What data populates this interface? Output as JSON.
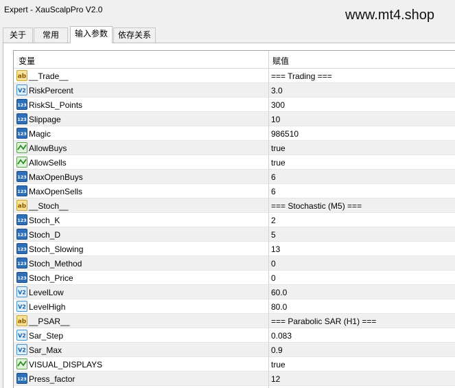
{
  "window": {
    "title": "Expert - XauScalpPro V2.0"
  },
  "watermark": "www.mt4.shop",
  "tabs": [
    {
      "label": "关于",
      "active": false
    },
    {
      "label": "常用",
      "active": false
    },
    {
      "label": "输入参数",
      "active": true
    },
    {
      "label": "依存关系",
      "active": false
    }
  ],
  "columns": {
    "variable": "变量",
    "value": "赋值"
  },
  "params": [
    {
      "icon": "ab-icon",
      "name": "__Trade__",
      "value": "=== Trading ==="
    },
    {
      "icon": "double-icon",
      "name": "RiskPercent",
      "value": "3.0"
    },
    {
      "icon": "integer-icon",
      "name": "RiskSL_Points",
      "value": "300"
    },
    {
      "icon": "integer-icon",
      "name": "Slippage",
      "value": "10"
    },
    {
      "icon": "integer-icon",
      "name": "Magic",
      "value": "986510"
    },
    {
      "icon": "bool-icon",
      "name": "AllowBuys",
      "value": "true"
    },
    {
      "icon": "bool-icon",
      "name": "AllowSells",
      "value": "true"
    },
    {
      "icon": "integer-icon",
      "name": "MaxOpenBuys",
      "value": "6"
    },
    {
      "icon": "integer-icon",
      "name": "MaxOpenSells",
      "value": "6"
    },
    {
      "icon": "ab-icon",
      "name": "__Stoch__",
      "value": "=== Stochastic (M5) ==="
    },
    {
      "icon": "integer-icon",
      "name": "Stoch_K",
      "value": "2"
    },
    {
      "icon": "integer-icon",
      "name": "Stoch_D",
      "value": "5"
    },
    {
      "icon": "integer-icon",
      "name": "Stoch_Slowing",
      "value": "13"
    },
    {
      "icon": "integer-icon",
      "name": "Stoch_Method",
      "value": "0"
    },
    {
      "icon": "integer-icon",
      "name": "Stoch_Price",
      "value": "0"
    },
    {
      "icon": "double-icon",
      "name": "LevelLow",
      "value": "60.0"
    },
    {
      "icon": "double-icon",
      "name": "LevelHigh",
      "value": "80.0"
    },
    {
      "icon": "ab-icon",
      "name": "__PSAR__",
      "value": "=== Parabolic SAR (H1) ==="
    },
    {
      "icon": "double-icon",
      "name": "Sar_Step",
      "value": "0.083"
    },
    {
      "icon": "double-icon",
      "name": "Sar_Max",
      "value": "0.9"
    },
    {
      "icon": "bool-icon",
      "name": "VISUAL_DISPLAYS",
      "value": "true"
    },
    {
      "icon": "integer-icon",
      "name": "Press_factor",
      "value": "12"
    }
  ],
  "icon_labels": {
    "ab": "ab",
    "integer": "123",
    "double": "V2"
  }
}
